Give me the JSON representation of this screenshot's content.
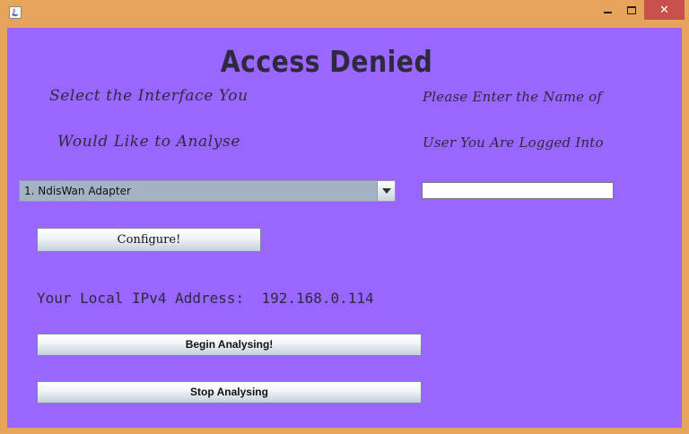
{
  "window": {
    "close_glyph": "✕"
  },
  "main": {
    "title": "Access Denied",
    "interface_prompt_line1": "Select the Interface You",
    "interface_prompt_line2": "Would Like to Analyse",
    "user_prompt_line1": "Please Enter the Name of",
    "user_prompt_line2": "User You Are Logged Into",
    "interface_selected": "1. NdisWan Adapter",
    "username_value": "",
    "configure_label": "Configure!",
    "ip_label": "Your Local IPv4 Address:",
    "ip_value": "192.168.0.114",
    "begin_label": "Begin Analysing!",
    "stop_label": "Stop Analysing"
  },
  "colors": {
    "content_background": "#9966ff",
    "window_frame": "#e6a45a",
    "close_button": "#c7504a",
    "text_dark": "#2e2a3e"
  },
  "icons": [
    "java-app-icon",
    "minimize-icon",
    "maximize-icon",
    "close-icon",
    "dropdown-arrow-icon"
  ]
}
